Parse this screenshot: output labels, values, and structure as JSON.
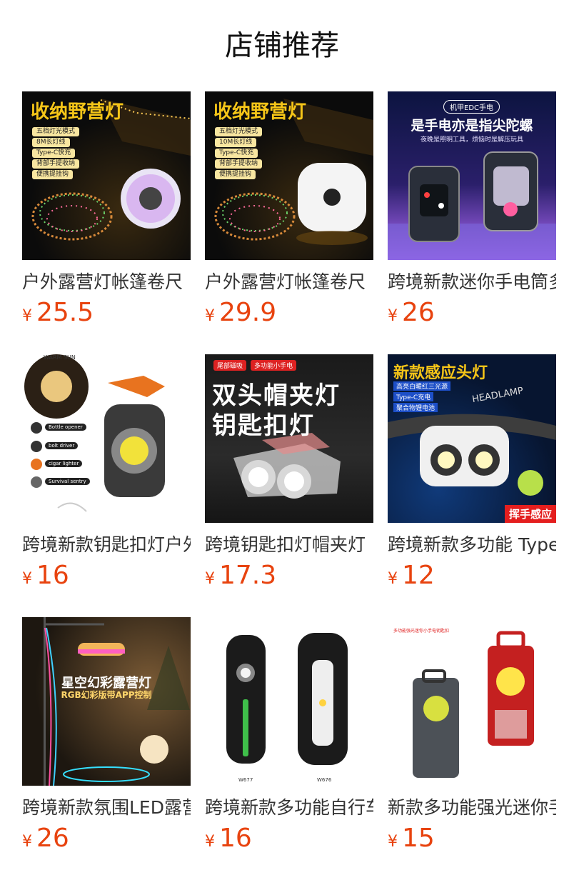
{
  "page": {
    "title": "店铺推荐"
  },
  "products": [
    {
      "name": "户外露营灯帐篷卷尺",
      "currency": "¥",
      "price": "25.5",
      "image": {
        "headline": "收纳野营灯",
        "pills": [
          "五档灯光模式",
          "8M长灯线",
          "Type-C快充",
          "背部手提收纳",
          "便携提挂钩"
        ]
      }
    },
    {
      "name": "户外露营灯帐篷卷尺",
      "currency": "¥",
      "price": "29.9",
      "image": {
        "headline": "收纳野营灯",
        "pills": [
          "五档灯光模式",
          "10M长灯线",
          "Type-C快充",
          "背部手提收纳",
          "便携提挂钩"
        ]
      }
    },
    {
      "name": "跨境新款迷你手电筒多",
      "currency": "¥",
      "price": "26",
      "image": {
        "badge": "机甲EDC手电",
        "headline": "是手电亦是指尖陀螺",
        "sub": "夜晚是照明工具，烦恼时是解压玩具"
      }
    },
    {
      "name": "跨境新款钥匙扣灯户外",
      "currency": "¥",
      "price": "16",
      "image": {
        "top": "WARM SUN",
        "labels": [
          "Bottle opener",
          "bolt driver",
          "cigar lighter",
          "Survival sentry"
        ]
      }
    },
    {
      "name": "跨境钥匙扣灯帽夹灯",
      "currency": "¥",
      "price": "17.3",
      "image": {
        "tags": [
          "尾部磁吸",
          "多功能小手电"
        ],
        "headline1": "双头帽夹灯",
        "headline2": "钥匙扣灯"
      }
    },
    {
      "name": "跨境新款多功能 Type",
      "currency": "¥",
      "price": "12",
      "image": {
        "headline": "新款感应头灯",
        "pills": [
          "高亮白暖红三光源",
          "Type-C充电",
          "聚合物锂电池"
        ],
        "brand": "HEADLAMP",
        "corner": "挥手感应"
      }
    },
    {
      "name": "跨境新款氛围LED露营",
      "currency": "¥",
      "price": "26",
      "image": {
        "headline": "星空幻彩露营灯",
        "sub": "RGB幻彩版带APP控制"
      }
    },
    {
      "name": "跨境新款多功能自行车",
      "currency": "¥",
      "price": "16",
      "image": {
        "models": [
          "W677",
          "W676"
        ]
      }
    },
    {
      "name": "新款多功能强光迷你手",
      "currency": "¥",
      "price": "15",
      "image": {
        "caption": "多功能强光迷你小手电钥匙扣"
      }
    }
  ]
}
